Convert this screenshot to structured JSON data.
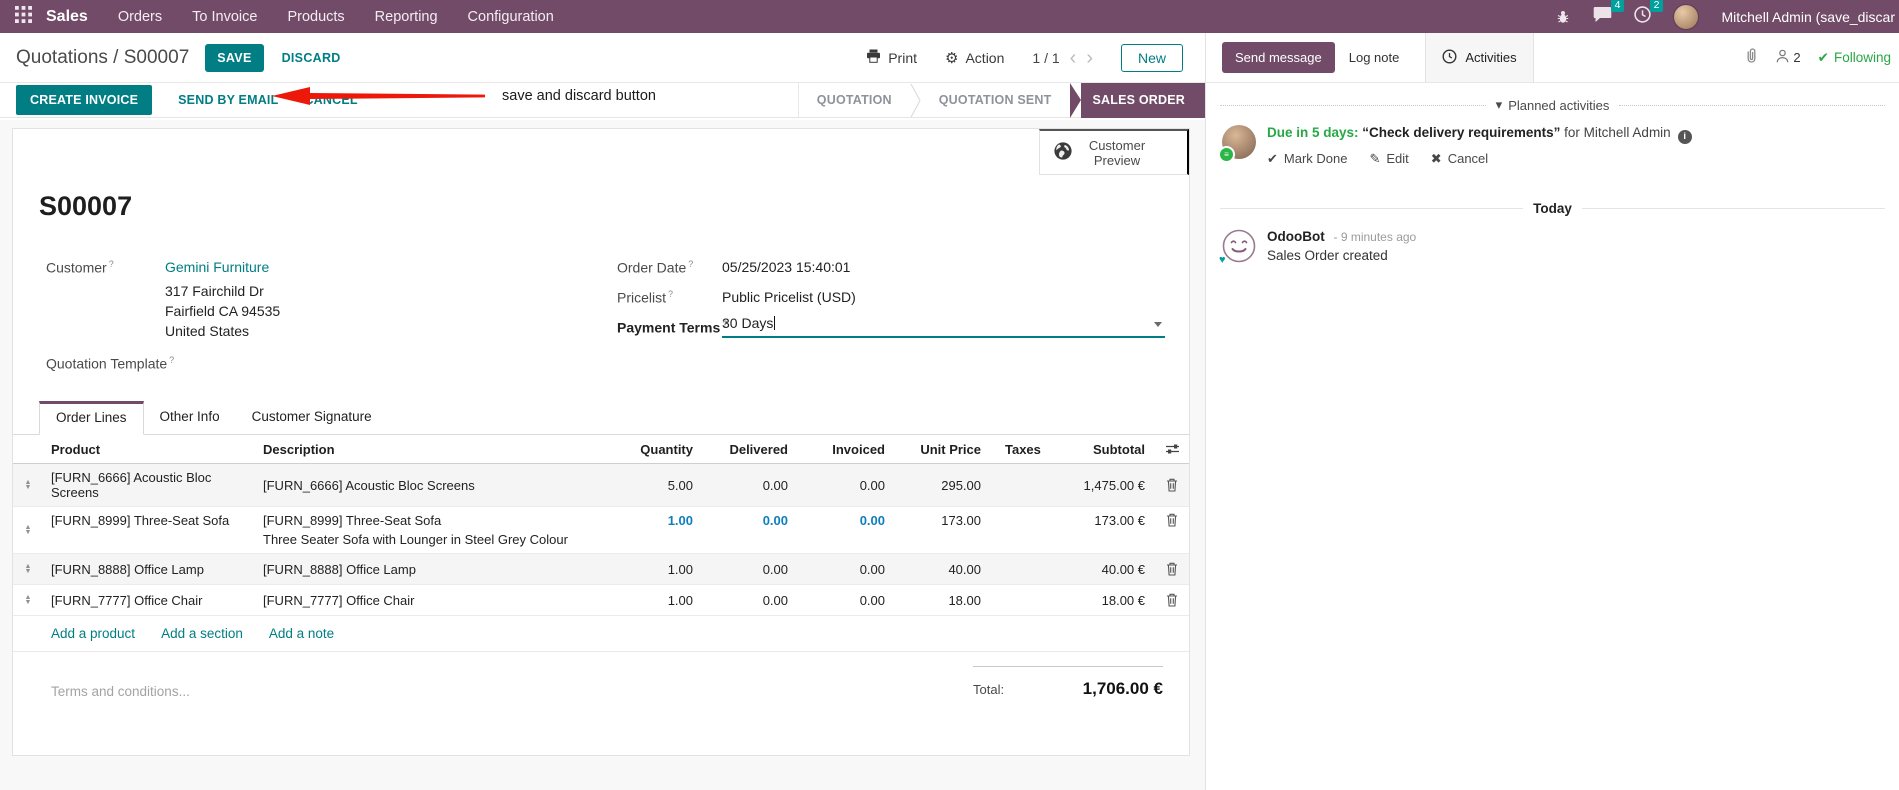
{
  "icons": {
    "prev": "‹",
    "next": "›",
    "gear": "⚙",
    "check": "✔",
    "pencil": "✎",
    "cross": "✖",
    "caret_down": "▾",
    "menu_list": "≡",
    "heart": "♥",
    "info": "i",
    "sort_up": "▲",
    "sort_down": "▼"
  },
  "topbar": {
    "app": "Sales",
    "menus": [
      "Orders",
      "To Invoice",
      "Products",
      "Reporting",
      "Configuration"
    ],
    "messages_badge": "4",
    "activities_badge": "2",
    "user_name": "Mitchell Admin (save_discar"
  },
  "control": {
    "breadcrumb_parent": "Quotations",
    "breadcrumb_separator": " / ",
    "breadcrumb_current": "S00007",
    "save": "SAVE",
    "discard": "DISCARD",
    "annotation": "save and discard button",
    "print": "Print",
    "action": "Action",
    "pager": "1 / 1",
    "new": "New"
  },
  "statusbar": {
    "create_invoice": "CREATE INVOICE",
    "send_by_email": "SEND BY EMAIL",
    "cancel": "CANCEL",
    "steps": [
      "QUOTATION",
      "QUOTATION SENT",
      "SALES ORDER"
    ]
  },
  "sheet": {
    "customer_preview": "Customer Preview",
    "title": "S00007",
    "help_marker": "?",
    "customer_label": "Customer",
    "customer_name": "Gemini Furniture",
    "address1": "317 Fairchild Dr",
    "address2": "Fairfield CA 94535",
    "address3": "United States",
    "quotation_template_label": "Quotation Template",
    "order_date_label": "Order Date",
    "order_date_value": "05/25/2023 15:40:01",
    "pricelist_label": "Pricelist",
    "pricelist_value": "Public Pricelist (USD)",
    "payment_terms_label": "Payment Terms",
    "payment_terms_value": "30 Days",
    "tabs": [
      "Order Lines",
      "Other Info",
      "Customer Signature"
    ],
    "table": {
      "headers": {
        "product": "Product",
        "description": "Description",
        "quantity": "Quantity",
        "delivered": "Delivered",
        "invoiced": "Invoiced",
        "unit_price": "Unit Price",
        "taxes": "Taxes",
        "subtotal": "Subtotal"
      },
      "lines": [
        {
          "product": "[FURN_6666] Acoustic Bloc Screens",
          "description": "[FURN_6666] Acoustic Bloc Screens",
          "quantity": "5.00",
          "delivered": "0.00",
          "invoiced": "0.00",
          "unit_price": "295.00",
          "taxes": "",
          "subtotal": "1,475.00 €"
        },
        {
          "product": "[FURN_8999] Three-Seat Sofa",
          "description": "[FURN_8999] Three-Seat Sofa",
          "description_note": "Three Seater Sofa with Lounger in Steel Grey Colour",
          "quantity": "1.00",
          "delivered": "0.00",
          "invoiced": "0.00",
          "unit_price": "173.00",
          "taxes": "",
          "subtotal": "173.00 €"
        },
        {
          "product": "[FURN_8888] Office Lamp",
          "description": "[FURN_8888] Office Lamp",
          "quantity": "1.00",
          "delivered": "0.00",
          "invoiced": "0.00",
          "unit_price": "40.00",
          "taxes": "",
          "subtotal": "40.00 €"
        },
        {
          "product": "[FURN_7777] Office Chair",
          "description": "[FURN_7777] Office Chair",
          "quantity": "1.00",
          "delivered": "0.00",
          "invoiced": "0.00",
          "unit_price": "18.00",
          "taxes": "",
          "subtotal": "18.00 €"
        }
      ],
      "add_product": "Add a product",
      "add_section": "Add a section",
      "add_note": "Add a note"
    },
    "terms_placeholder": "Terms and conditions...",
    "total_label": "Total:",
    "total_value": "1,706.00 €"
  },
  "chatter": {
    "send_message": "Send message",
    "log_note": "Log note",
    "activities": "Activities",
    "followers_count": "2",
    "following": "Following",
    "planned_activities": "Planned activities",
    "activity": {
      "due": "Due in 5 days:",
      "summary": "“Check delivery requirements”",
      "assignee": "for Mitchell Admin",
      "mark_done": "Mark Done",
      "edit": "Edit",
      "cancel": "Cancel"
    },
    "today": "Today",
    "message": {
      "author": "OdooBot",
      "time": "- 9 minutes ago",
      "body": "Sales Order created"
    }
  },
  "colors": {
    "brand": "#714B67",
    "primary": "#017E84",
    "badge": "#00A09D",
    "green": "#28a745",
    "modified_blue": "#0d7fbf",
    "arrow_red": "#ec1809"
  }
}
